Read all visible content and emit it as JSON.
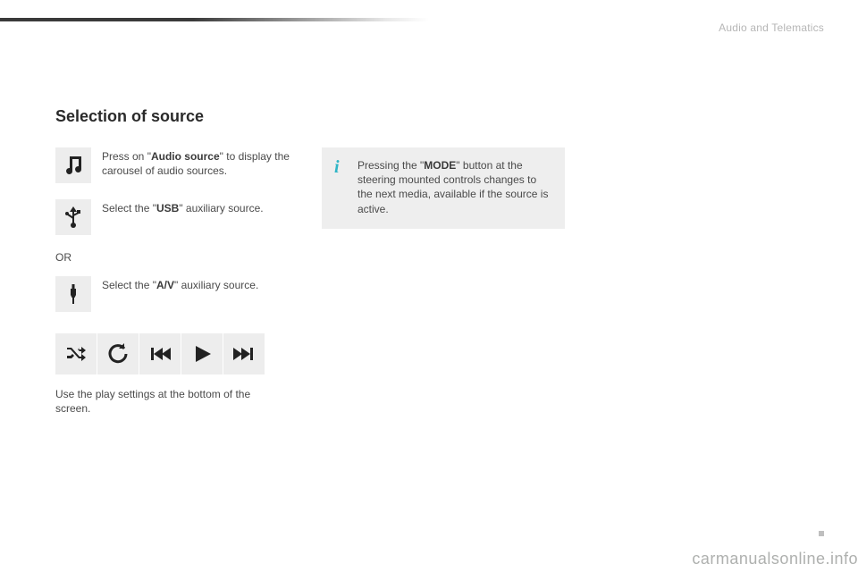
{
  "header": {
    "section": "Audio and Telematics"
  },
  "main": {
    "heading": "Selection of source",
    "steps": {
      "audio_source": {
        "pre": "Press on \"",
        "bold": "Audio source",
        "post": "\" to display the carousel of audio sources."
      },
      "usb": {
        "pre": "Select the \"",
        "bold": "USB",
        "post": "\" auxiliary source."
      },
      "or": "OR",
      "av": {
        "pre": "Select the \"",
        "bold": "A/V",
        "post": "\" auxiliary source."
      }
    },
    "playbar_caption": "Use the play settings at the bottom of the screen.",
    "info": {
      "pre": "Pressing the \"",
      "bold": "MODE",
      "post": "\" button at the steering mounted controls changes to the next media, available if the source is active."
    }
  },
  "footer": {
    "watermark": "carmanualsonline.info"
  },
  "icons": {
    "music": "music-note-icon",
    "usb": "usb-icon",
    "av": "av-plug-icon",
    "shuffle": "shuffle-icon",
    "repeat": "repeat-icon",
    "prev": "previous-track-icon",
    "play": "play-icon",
    "next": "next-track-icon"
  }
}
